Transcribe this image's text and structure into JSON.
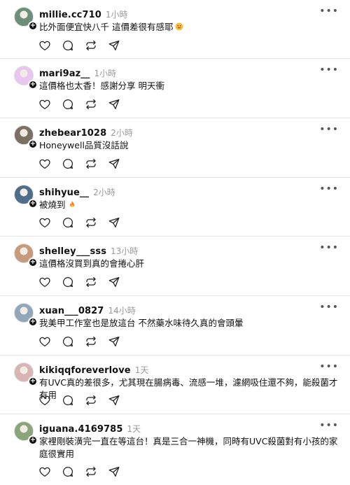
{
  "comments": [
    {
      "username": "millie.cc710",
      "time": "1小時",
      "text": "比外面便宜快八千 這價差很有感耶",
      "emoji": "heart-eyes",
      "avatar_color": "#6d8f7a"
    },
    {
      "username": "mari9az__",
      "time": "1小時",
      "text": "這價格也太香！感謝分享 明天衝",
      "emoji": "",
      "avatar_color": "#e9c6f0"
    },
    {
      "username": "zhebear1028",
      "time": "2小時",
      "text": "Honeywell品質沒話說",
      "emoji": "",
      "avatar_color": "#7a7063"
    },
    {
      "username": "shihyue__",
      "time": "2小時",
      "text": "被燒到",
      "emoji": "fire",
      "avatar_color": "#4f6d8a"
    },
    {
      "username": "shelley___sss",
      "time": "13小時",
      "text": "這價格沒買到真的會捲心肝",
      "emoji": "",
      "avatar_color": "#c79a7c"
    },
    {
      "username": "xuan___0827",
      "time": "14小時",
      "text": "我美甲工作室也是放這台 不然藥水味待久真的會頭暈",
      "emoji": "",
      "avatar_color": "#8fa7b8"
    },
    {
      "username": "kikiqqforeverlove",
      "time": "1天",
      "text": "有UVC真的差很多，尤其現在腸病毒、流感一堆，濾網吸住還不夠，能殺菌才有用",
      "emoji": "",
      "avatar_color": "#d9b4b4"
    },
    {
      "username": "iguana.4169785",
      "time": "1天",
      "text": "家裡剛裝潢完一直在等這台！真是三合一神機，同時有UVC殺菌對有小孩的家庭很實用",
      "emoji": "",
      "avatar_color": "#8aa57a"
    }
  ],
  "icons": {
    "more": "more-dots-icon",
    "like": "heart-icon",
    "reply": "comment-icon",
    "repost": "repost-icon",
    "share": "share-icon",
    "follow": "plus-icon"
  },
  "more_glyph": "•••",
  "follow_glyph": "+"
}
